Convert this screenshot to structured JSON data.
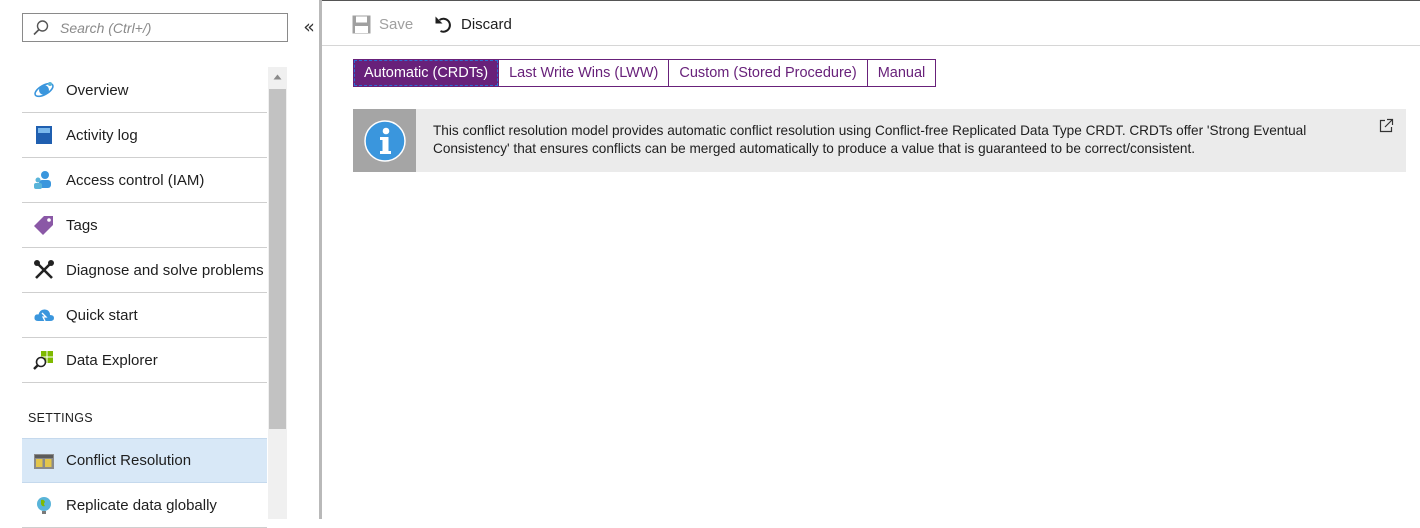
{
  "sidebar": {
    "search_placeholder": "Search (Ctrl+/)",
    "collapse_glyph": "«",
    "items": [
      {
        "label": "Overview",
        "icon": "overview-icon"
      },
      {
        "label": "Activity log",
        "icon": "activity-log-icon"
      },
      {
        "label": "Access control (IAM)",
        "icon": "access-control-icon"
      },
      {
        "label": "Tags",
        "icon": "tag-icon"
      },
      {
        "label": "Diagnose and solve problems",
        "icon": "wrench-icon"
      },
      {
        "label": "Quick start",
        "icon": "cloud-icon"
      },
      {
        "label": "Data Explorer",
        "icon": "data-explorer-icon"
      }
    ],
    "settings_label": "SETTINGS",
    "settings_items": [
      {
        "label": "Conflict Resolution",
        "icon": "conflict-resolution-icon",
        "selected": true
      },
      {
        "label": "Replicate data globally",
        "icon": "globe-icon",
        "selected": false
      }
    ]
  },
  "toolbar": {
    "save_label": "Save",
    "discard_label": "Discard"
  },
  "tabs": [
    {
      "label": "Automatic (CRDTs)",
      "active": true
    },
    {
      "label": "Last Write Wins (LWW)",
      "active": false
    },
    {
      "label": "Custom (Stored Procedure)",
      "active": false
    },
    {
      "label": "Manual",
      "active": false
    }
  ],
  "info": {
    "text": "This conflict resolution model provides automatic conflict resolution using Conflict-free Replicated Data Type CRDT. CRDTs offer 'Strong Eventual Consistency'  that ensures conflicts can be merged automatically to produce a value that is guaranteed to be correct/consistent."
  },
  "colors": {
    "accent": "#68217a",
    "selected_bg": "#d8e8f7",
    "info_bg": "#ebebeb"
  }
}
